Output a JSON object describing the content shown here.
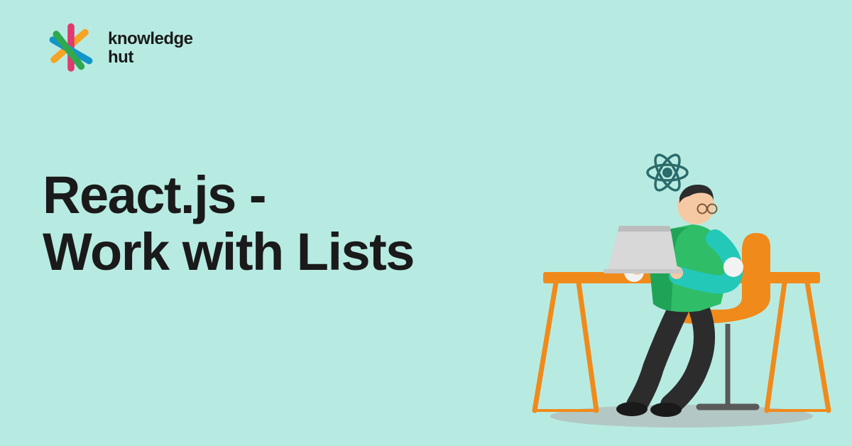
{
  "brand": {
    "line1": "knowledge",
    "line2": "hut"
  },
  "headline": {
    "line1": "React.js -",
    "line2": "Work with Lists"
  }
}
